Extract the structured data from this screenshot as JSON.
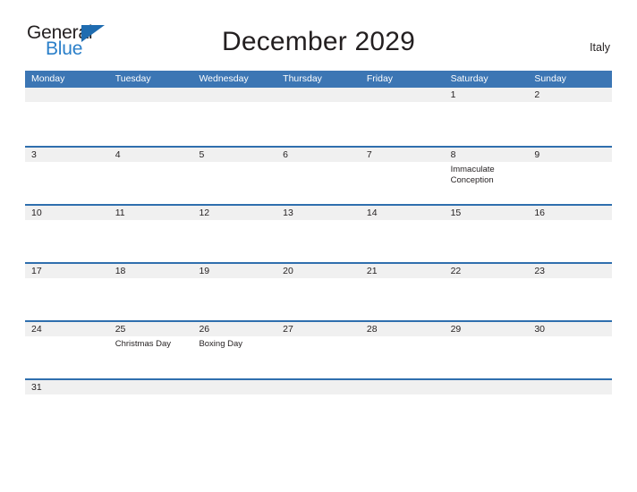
{
  "brand": {
    "word_one": "General",
    "word_two": "Blue",
    "flag_icon": "triangle-flag-icon",
    "color_dark": "#231f20",
    "color_blue": "#2a7fc9"
  },
  "header": {
    "title": "December 2029",
    "country": "Italy"
  },
  "calendar": {
    "accent_color": "#3c76b4",
    "band_color": "#f0f0f0",
    "weekdays": [
      "Monday",
      "Tuesday",
      "Wednesday",
      "Thursday",
      "Friday",
      "Saturday",
      "Sunday"
    ],
    "weeks": [
      [
        {
          "day": ""
        },
        {
          "day": ""
        },
        {
          "day": ""
        },
        {
          "day": ""
        },
        {
          "day": ""
        },
        {
          "day": "1",
          "events": []
        },
        {
          "day": "2",
          "events": []
        }
      ],
      [
        {
          "day": "3",
          "events": []
        },
        {
          "day": "4",
          "events": []
        },
        {
          "day": "5",
          "events": []
        },
        {
          "day": "6",
          "events": []
        },
        {
          "day": "7",
          "events": []
        },
        {
          "day": "8",
          "events": [
            "Immaculate Conception"
          ]
        },
        {
          "day": "9",
          "events": []
        }
      ],
      [
        {
          "day": "10",
          "events": []
        },
        {
          "day": "11",
          "events": []
        },
        {
          "day": "12",
          "events": []
        },
        {
          "day": "13",
          "events": []
        },
        {
          "day": "14",
          "events": []
        },
        {
          "day": "15",
          "events": []
        },
        {
          "day": "16",
          "events": []
        }
      ],
      [
        {
          "day": "17",
          "events": []
        },
        {
          "day": "18",
          "events": []
        },
        {
          "day": "19",
          "events": []
        },
        {
          "day": "20",
          "events": []
        },
        {
          "day": "21",
          "events": []
        },
        {
          "day": "22",
          "events": []
        },
        {
          "day": "23",
          "events": []
        }
      ],
      [
        {
          "day": "24",
          "events": []
        },
        {
          "day": "25",
          "events": [
            "Christmas Day"
          ]
        },
        {
          "day": "26",
          "events": [
            "Boxing Day"
          ]
        },
        {
          "day": "27",
          "events": []
        },
        {
          "day": "28",
          "events": []
        },
        {
          "day": "29",
          "events": []
        },
        {
          "day": "30",
          "events": []
        }
      ],
      [
        {
          "day": "31",
          "events": []
        },
        {
          "day": ""
        },
        {
          "day": ""
        },
        {
          "day": ""
        },
        {
          "day": ""
        },
        {
          "day": ""
        },
        {
          "day": ""
        }
      ]
    ]
  }
}
